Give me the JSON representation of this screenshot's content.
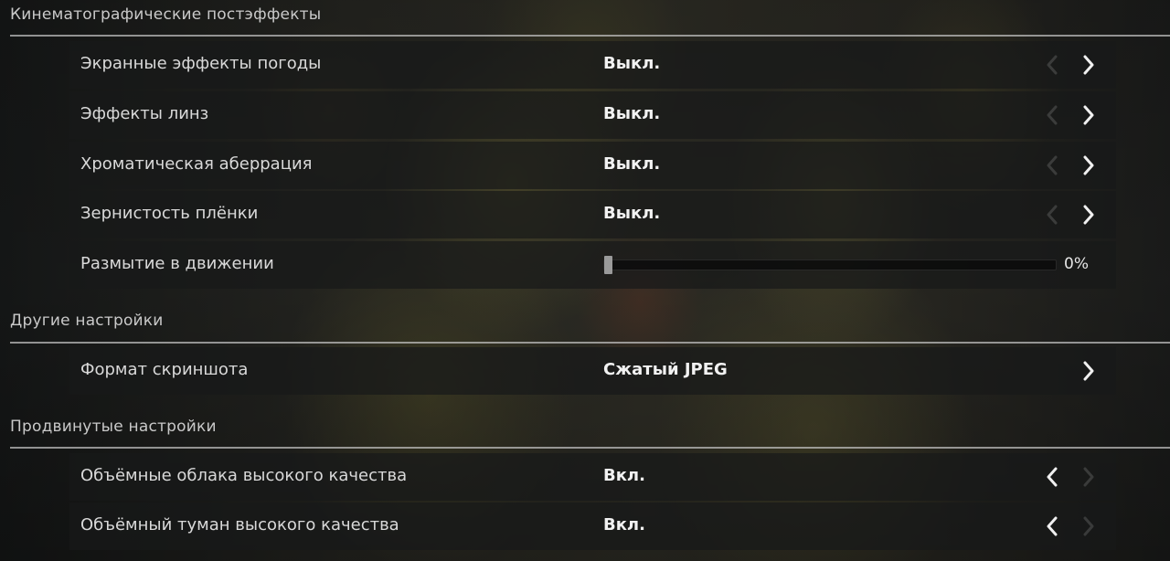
{
  "sections": {
    "cinematic": {
      "title": "Кинематографические постэффекты",
      "rows": [
        {
          "label": "Экранные эффекты погоды",
          "value": "Выкл."
        },
        {
          "label": "Эффекты линз",
          "value": "Выкл."
        },
        {
          "label": "Хроматическая аберрация",
          "value": "Выкл."
        },
        {
          "label": "Зернистость плёнки",
          "value": "Выкл."
        }
      ],
      "motion_blur": {
        "label": "Размытие в движении",
        "value_text": "0%",
        "value": 0
      }
    },
    "other": {
      "title": "Другие настройки",
      "rows": [
        {
          "label": "Формат скриншота",
          "value": "Сжатый JPEG"
        }
      ]
    },
    "advanced": {
      "title": "Продвинутые настройки",
      "rows": [
        {
          "label": "Объёмные облака высокого качества",
          "value": "Вкл."
        },
        {
          "label": "Объёмный туман высокого качества",
          "value": "Вкл."
        }
      ]
    }
  },
  "icons": {
    "left_arrow": "chevron-left-icon",
    "right_arrow": "chevron-right-icon"
  },
  "colors": {
    "row_background": "#181919",
    "text": "#e6e6e6",
    "divider": "#c8c8c8"
  }
}
